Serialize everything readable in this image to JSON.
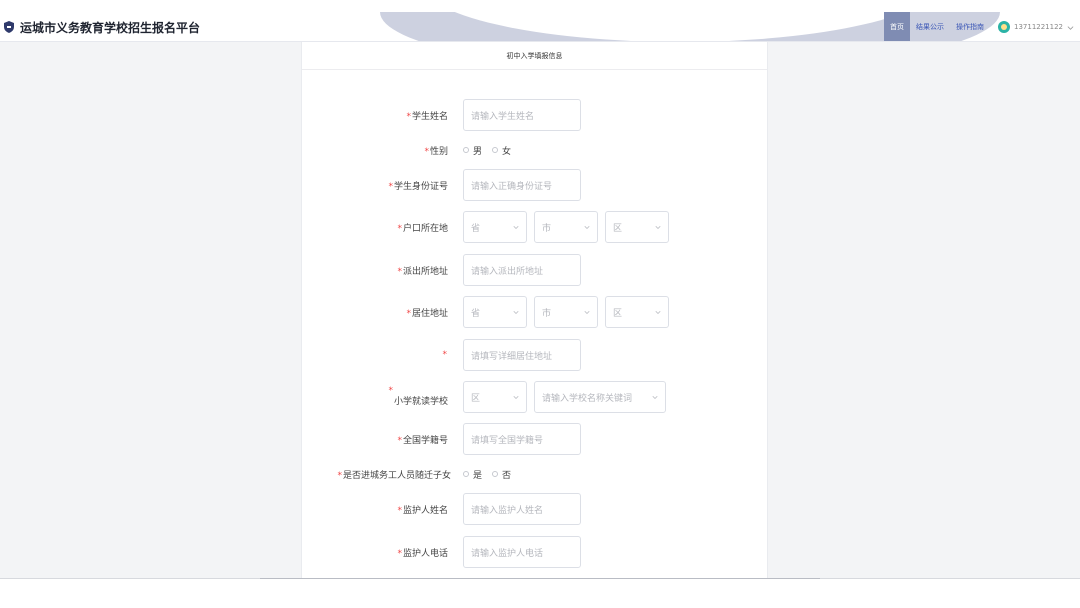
{
  "header": {
    "title": "运城市义务教育学校招生报名平台",
    "nav": [
      {
        "label": "首页",
        "active": true
      },
      {
        "label": "结果公示",
        "active": false
      },
      {
        "label": "操作指南",
        "active": false
      }
    ],
    "user_phone": "13711221122"
  },
  "panel": {
    "title": "初中入学填报信息"
  },
  "form": {
    "student_name": {
      "label": "学生姓名",
      "placeholder": "请输入学生姓名"
    },
    "gender": {
      "label": "性别",
      "options": [
        "男",
        "女"
      ]
    },
    "student_id": {
      "label": "学生身份证号",
      "placeholder": "请输入正确身份证号"
    },
    "hukou": {
      "label": "户口所在地",
      "province": "省",
      "city": "市",
      "district": "区"
    },
    "police_address": {
      "label": "派出所地址",
      "placeholder": "请输入派出所地址"
    },
    "residence": {
      "label": "居住地址",
      "province": "省",
      "city": "市",
      "district": "区"
    },
    "residence_detail": {
      "placeholder": "请填写详细居住地址"
    },
    "primary_school": {
      "label": "小学就读学校",
      "district": "区",
      "school_placeholder": "请输入学校名称关键词"
    },
    "student_number": {
      "label": "全国学籍号",
      "placeholder": "请填写全国学籍号"
    },
    "migrant": {
      "label": "是否进城务工人员随迁子女",
      "options": [
        "是",
        "否"
      ]
    },
    "guardian_name": {
      "label": "监护人姓名",
      "placeholder": "请输入监护人姓名"
    },
    "guardian_phone": {
      "label": "监护人电话",
      "placeholder": "请输入监护人电话"
    }
  },
  "colors": {
    "accent": "#7f8cb3",
    "required": "#f04848",
    "nav_text": "#3a56b6"
  }
}
